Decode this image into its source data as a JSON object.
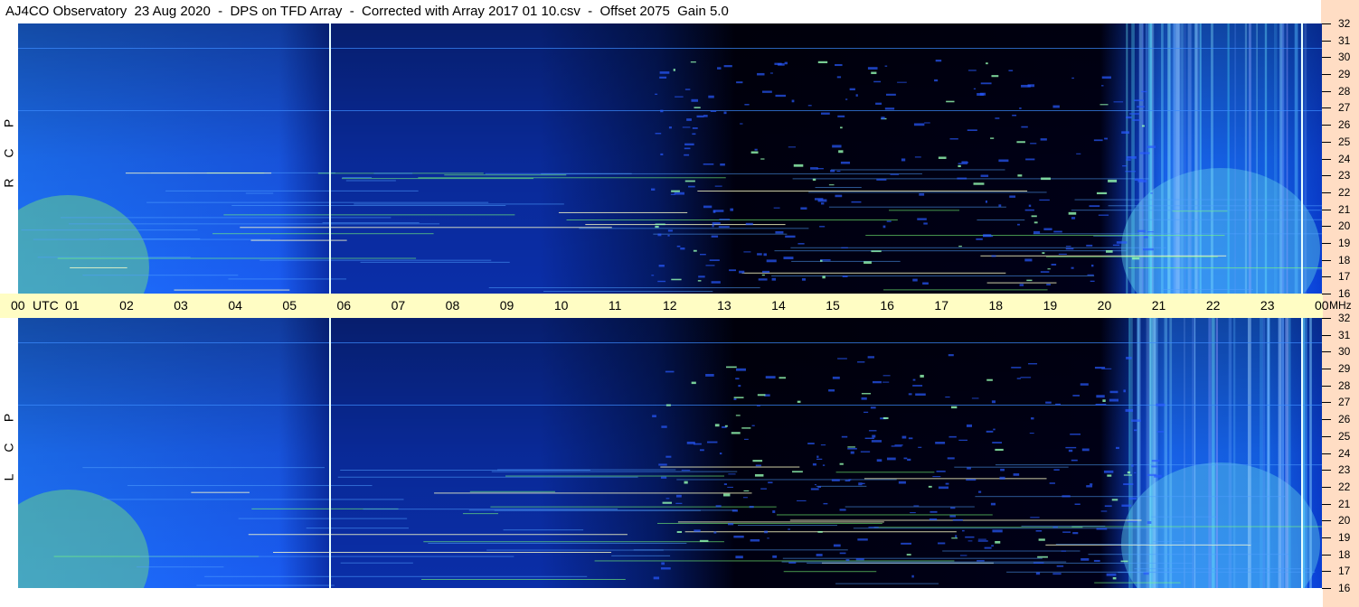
{
  "title": "AJ4CO Observatory  23 Aug 2020  -  DPS on TFD Array  -  Corrected with Array 2017 01 10.csv  -  Offset 2075  Gain 5.0",
  "colors": {
    "title_bg": "#ffffff",
    "time_axis_bg": "#fffdc4",
    "freq_axis_bg": "#ffddc4",
    "spectrogram_blue": "#1a5cff",
    "spectrogram_dark": "#000000",
    "spectrogram_hot": "#7fff5a"
  },
  "chart_data": [
    {
      "type": "heatmap",
      "panel": "RCP",
      "ylabel": "R C P",
      "xlabel": "UTC",
      "ylabel_units": "MHz",
      "x_ticks": [
        "00",
        "01",
        "02",
        "03",
        "04",
        "05",
        "06",
        "07",
        "08",
        "09",
        "10",
        "11",
        "12",
        "13",
        "14",
        "15",
        "16",
        "17",
        "18",
        "19",
        "20",
        "21",
        "22",
        "23",
        "00"
      ],
      "y_ticks": [
        "16",
        "17",
        "18",
        "19",
        "20",
        "21",
        "22",
        "23",
        "24",
        "25",
        "26",
        "27",
        "28",
        "29",
        "30",
        "31",
        "32"
      ],
      "xlim_utc_hours": [
        0,
        24
      ],
      "ylim_mhz": [
        16,
        32
      ]
    },
    {
      "type": "heatmap",
      "panel": "LCP",
      "ylabel": "L C P",
      "xlabel": "UTC",
      "ylabel_units": "MHz",
      "x_ticks": [
        "00",
        "01",
        "02",
        "03",
        "04",
        "05",
        "06",
        "07",
        "08",
        "09",
        "10",
        "11",
        "12",
        "13",
        "14",
        "15",
        "16",
        "17",
        "18",
        "19",
        "20",
        "21",
        "22",
        "23",
        "00"
      ],
      "y_ticks": [
        "16",
        "17",
        "18",
        "19",
        "20",
        "21",
        "22",
        "23",
        "24",
        "25",
        "26",
        "27",
        "28",
        "29",
        "30",
        "31",
        "32"
      ],
      "xlim_utc_hours": [
        0,
        24
      ],
      "ylim_mhz": [
        16,
        32
      ]
    }
  ],
  "axis": {
    "utc_label": "UTC",
    "mhz_label": "MHz",
    "rcp_letters": [
      "R",
      "C",
      "P"
    ],
    "lcp_letters": [
      "L",
      "C",
      "P"
    ]
  }
}
